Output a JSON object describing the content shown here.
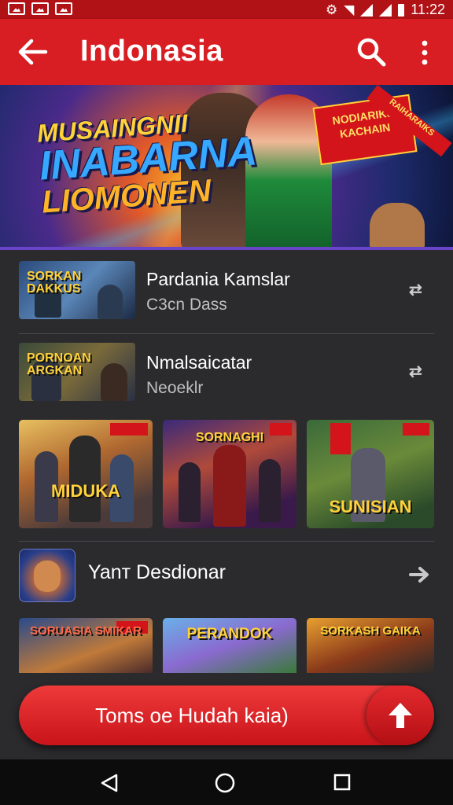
{
  "status_bar": {
    "time": "11:22"
  },
  "app_bar": {
    "title": "Indonasia"
  },
  "banner": {
    "line1": "MUSAINGNII",
    "line2": "INABARNA",
    "line3": "LIOMONEN",
    "badge": "NODIARIKS KACHAIN",
    "ribbon": "RAIHARAIKS"
  },
  "list": [
    {
      "title": "Pardania Kamslar",
      "subtitle": "C3cn Dass",
      "thumb_text": "SORKAN DAKKUS",
      "action_icon": "swap-icon"
    },
    {
      "title": "Nmalsaicatar",
      "subtitle": "Neoeklr",
      "thumb_text": "PORNOAN ARGKAN",
      "action_icon": "swap-icon"
    }
  ],
  "grid_top": [
    {
      "label": "MIDUKA"
    },
    {
      "label": "SORNAGHI"
    },
    {
      "label": "SUNISIAN"
    }
  ],
  "section": {
    "title": "Yanт Desdionar"
  },
  "grid_bottom": [
    {
      "label": "SORUASIA SMIKAR"
    },
    {
      "label": "PERANDOK"
    },
    {
      "label": "SORKASH GAIKA"
    }
  ],
  "cta": {
    "label": "Toms oe Hudah kaia)"
  },
  "colors": {
    "primary": "#d81e22",
    "status": "#b01216",
    "background": "#2b2b2e"
  }
}
